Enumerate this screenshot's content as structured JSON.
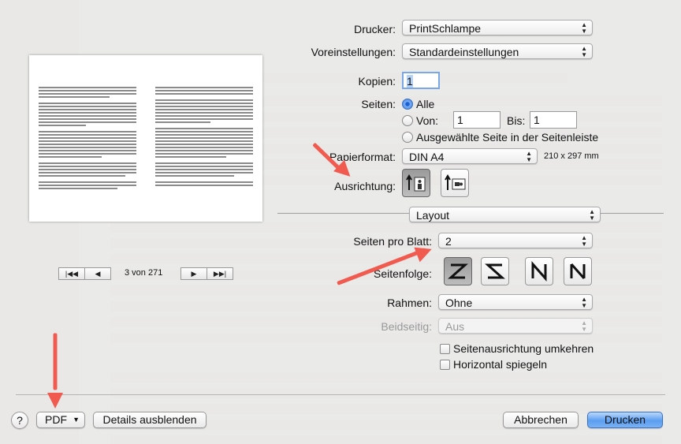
{
  "printer": {
    "label": "Drucker:",
    "value": "PrintSchlampe"
  },
  "presets": {
    "label": "Voreinstellungen:",
    "value": "Standardeinstellungen"
  },
  "copies": {
    "label": "Kopien:",
    "value": "1"
  },
  "pages": {
    "label": "Seiten:",
    "all_label": "Alle",
    "from_label": "Von:",
    "from_value": "1",
    "to_label": "Bis:",
    "to_value": "1",
    "selected_label": "Ausgewählte Seite in der Seitenleiste"
  },
  "paper": {
    "label": "Papierformat:",
    "value": "DIN A4",
    "dims": "210 x 297 mm"
  },
  "orientation": {
    "label": "Ausrichtung:"
  },
  "section": {
    "value": "Layout"
  },
  "pages_per_sheet": {
    "label": "Seiten pro Blatt:",
    "value": "2"
  },
  "layout_direction": {
    "label": "Seitenfolge:"
  },
  "border": {
    "label": "Rahmen:",
    "value": "Ohne"
  },
  "two_sided": {
    "label": "Beidseitig:",
    "value": "Aus"
  },
  "options": {
    "reverse_orientation": "Seitenausrichtung umkehren",
    "flip_horizontal": "Horizontal spiegeln"
  },
  "preview_nav": {
    "page_indicator": "3 von 271"
  },
  "footer": {
    "help": "?",
    "pdf": "PDF",
    "hide_details": "Details ausblenden",
    "cancel": "Abbrechen",
    "print": "Drucken"
  },
  "annotation": {
    "arrow_color": "#f05a4f"
  },
  "colors": {
    "accent": "#5b9ef0"
  }
}
